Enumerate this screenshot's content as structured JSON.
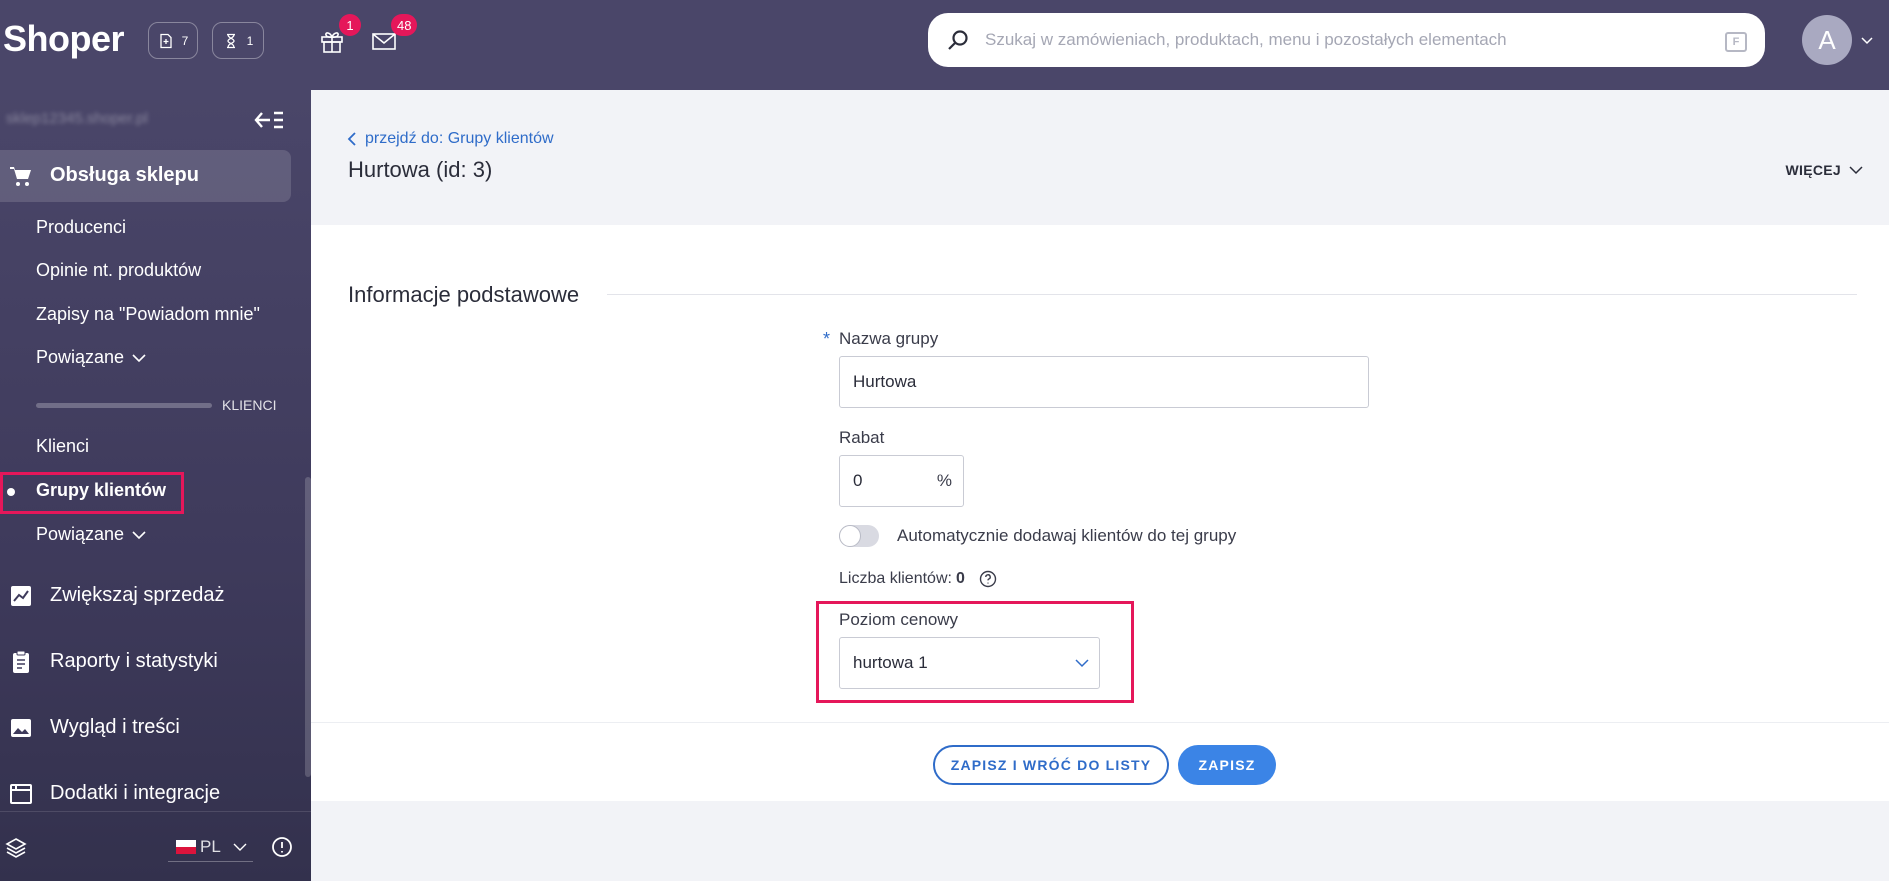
{
  "topbar": {
    "logo": "Shoper",
    "pill_docs_count": "7",
    "pill_timer_count": "1",
    "gift_badge": "1",
    "mail_badge": "48",
    "search_placeholder": "Szukaj w zamówieniach, produktach, menu i pozostałych elementach",
    "search_shortcut": "F",
    "avatar_initial": "A"
  },
  "sidebar": {
    "store_name": "sklep12345.shoper.pl",
    "section_title": "Obsługa sklepu",
    "items": [
      {
        "label": "Producenci"
      },
      {
        "label": "Opinie nt. produktów"
      },
      {
        "label": "Zapisy na \"Powiadom mnie\""
      },
      {
        "label": "Powiązane"
      }
    ],
    "clients_group_label": "KLIENCI",
    "client_items": [
      {
        "label": "Klienci"
      },
      {
        "label": "Grupy klientów"
      },
      {
        "label": "Powiązane"
      }
    ],
    "main_items": [
      {
        "label": "Zwiększaj sprzedaż"
      },
      {
        "label": "Raporty i statystyki"
      },
      {
        "label": "Wygląd i treści"
      },
      {
        "label": "Dodatki i integracje"
      }
    ],
    "language": "PL"
  },
  "header": {
    "back_link": "przejdź do: Grupy klientów",
    "title": "Hurtowa (id: 3)",
    "more_label": "WIĘCEJ"
  },
  "form": {
    "section_title": "Informacje podstawowe",
    "required_mark": "*",
    "name_label": "Nazwa grupy",
    "name_value": "Hurtowa",
    "discount_label": "Rabat",
    "discount_value": "0",
    "discount_unit": "%",
    "auto_add_label": "Automatycznie dodawaj klientów do tej grupy",
    "auto_add_enabled": false,
    "count_label": "Liczba klientów:",
    "count_value": "0",
    "price_level_label": "Poziom cenowy",
    "price_level_value": "hurtowa 1"
  },
  "footer": {
    "save_back_label": "ZAPISZ I WRÓĆ DO LISTY",
    "save_label": "ZAPISZ"
  },
  "colors": {
    "topbar": "#4a4669",
    "accent_blue": "#3b84e6",
    "link_blue": "#2f6cc9",
    "highlight": "#e5175a"
  }
}
